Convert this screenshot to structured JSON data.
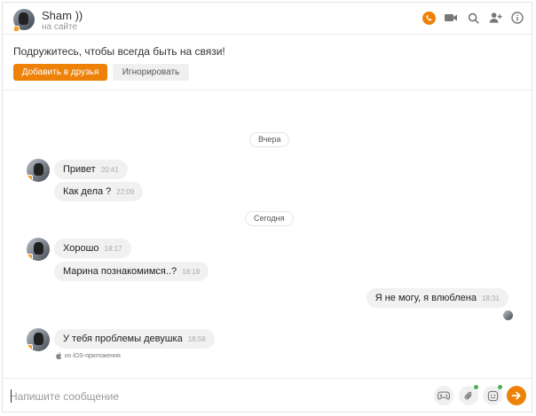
{
  "header": {
    "name": "Sham ))",
    "presence": "на сайте",
    "icons": [
      "phone-icon",
      "video-icon",
      "search-icon",
      "add-user-icon",
      "info-icon"
    ]
  },
  "banner": {
    "prompt": "Подружитесь, чтобы всегда быть на связи!",
    "add_label": "Добавить в друзья",
    "ignore_label": "Игнорировать"
  },
  "dates": {
    "yesterday": "Вчера",
    "today": "Сегодня"
  },
  "messages": [
    {
      "text": "Привет",
      "time": "20:41",
      "direction": "in"
    },
    {
      "text": "Как дела ?",
      "time": "22:09",
      "direction": "in"
    },
    {
      "text": "Хорошо",
      "time": "18:17",
      "direction": "in"
    },
    {
      "text": "Марина познакомимся..?",
      "time": "18:18",
      "direction": "in"
    },
    {
      "text": "Я не могу, я влюблена",
      "time": "18:31",
      "direction": "out"
    },
    {
      "text": "У тебя проблемы девушка",
      "time": "18:58",
      "direction": "in"
    }
  ],
  "ios_note": "из iOS-приложения",
  "composer": {
    "placeholder": "Напишите сообщение"
  },
  "colors": {
    "accent": "#ee8208",
    "online_badge": "#f59c23",
    "bubble": "#f1f1f1"
  }
}
